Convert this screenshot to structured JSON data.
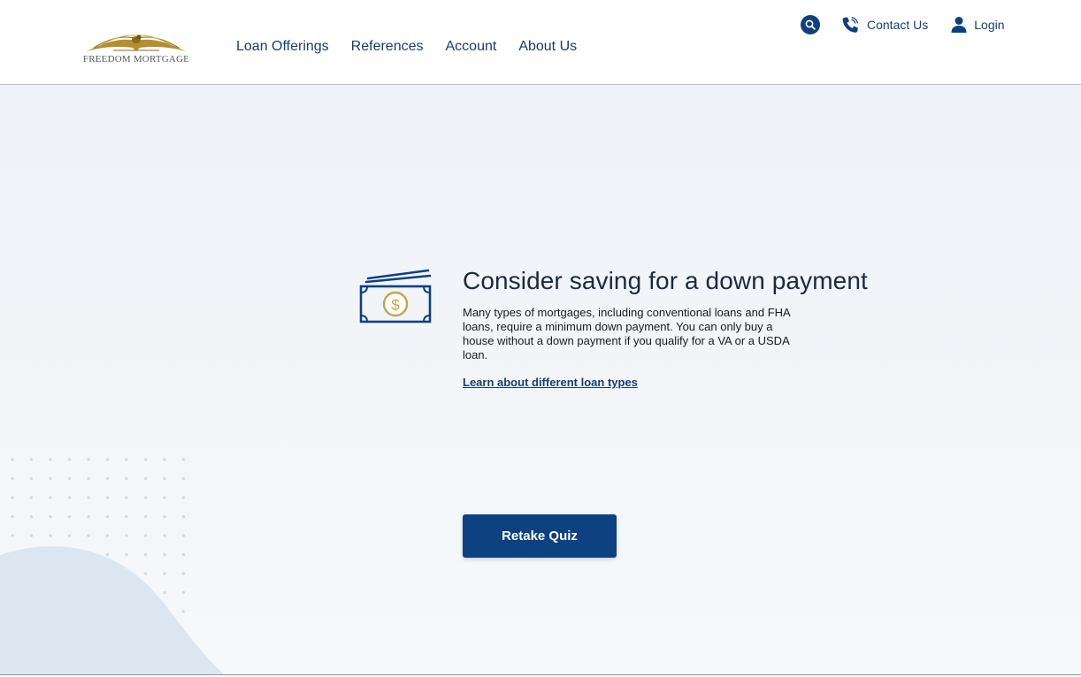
{
  "brand": {
    "name": "FREEDOM MORTGAGE"
  },
  "nav": {
    "items": [
      {
        "label": "Loan Offerings"
      },
      {
        "label": "References"
      },
      {
        "label": "Account"
      },
      {
        "label": "About Us"
      }
    ]
  },
  "utility": {
    "search_icon": "search-icon",
    "contact_label": "Contact Us",
    "login_label": "Login"
  },
  "result": {
    "icon": "money-bill-icon",
    "title": "Consider saving for a down payment",
    "description": "Many types of mortgages, including conventional loans and FHA loans, require a minimum down payment. You can only buy a house without a down payment if you qualify for a VA or a USDA loan.",
    "link_label": "Learn about different loan types"
  },
  "actions": {
    "retake_label": "Retake Quiz"
  },
  "colors": {
    "primary": "#0e4181",
    "nav_text": "#173e6e",
    "logo_gold": "#b58f2f",
    "accent_coin": "#c9a24a"
  }
}
